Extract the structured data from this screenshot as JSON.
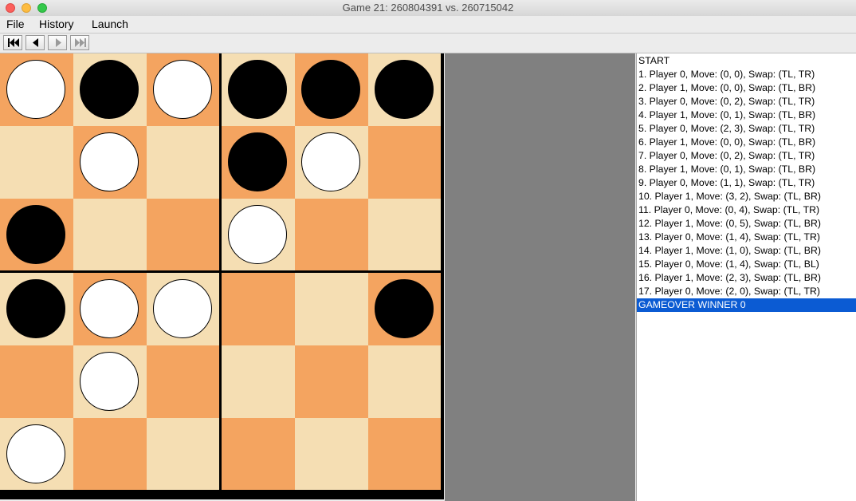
{
  "window": {
    "title": "Game 21: 260804391 vs. 260715042"
  },
  "menu": [
    "File",
    "History",
    "Launch"
  ],
  "toolbar": {
    "buttons": [
      "first-move",
      "previous-move",
      "next-move",
      "last-move"
    ]
  },
  "board": {
    "rows": [
      [
        "white",
        "black",
        "white",
        "black",
        "black",
        "black"
      ],
      [
        "",
        "white",
        "",
        "black",
        "white",
        ""
      ],
      [
        "black",
        "",
        "",
        "white",
        "",
        ""
      ],
      [
        "black",
        "white",
        "white",
        "",
        "",
        "black"
      ],
      [
        "",
        "white",
        "",
        "",
        "",
        ""
      ],
      [
        "white",
        "",
        "",
        "",
        "",
        ""
      ]
    ],
    "colors": {
      "dark": "#f4a460",
      "light": "#f5deb3",
      "grid": "#000000"
    }
  },
  "history": {
    "lines": [
      "START",
      "1. Player 0, Move: (0, 0), Swap: (TL, TR)",
      "2. Player 1, Move: (0, 0), Swap: (TL, BR)",
      "3. Player 0, Move: (0, 2), Swap: (TL, TR)",
      "4. Player 1, Move: (0, 1), Swap: (TL, BR)",
      "5. Player 0, Move: (2, 3), Swap: (TL, TR)",
      "6. Player 1, Move: (0, 0), Swap: (TL, BR)",
      "7. Player 0, Move: (0, 2), Swap: (TL, TR)",
      "8. Player 1, Move: (0, 1), Swap: (TL, BR)",
      "9. Player 0, Move: (1, 1), Swap: (TL, TR)",
      "10. Player 1, Move: (3, 2), Swap: (TL, BR)",
      "11. Player 0, Move: (0, 4), Swap: (TL, TR)",
      "12. Player 1, Move: (0, 5), Swap: (TL, BR)",
      "13. Player 0, Move: (1, 4), Swap: (TL, TR)",
      "14. Player 1, Move: (1, 0), Swap: (TL, BR)",
      "15. Player 0, Move: (1, 4), Swap: (TL, BL)",
      "16. Player 1, Move: (2, 3), Swap: (TL, BR)",
      "17. Player 0, Move: (2, 0), Swap: (TL, TR)",
      "GAMEOVER WINNER 0"
    ],
    "selected_index": 18,
    "selection_color": "#0b5bd3"
  }
}
